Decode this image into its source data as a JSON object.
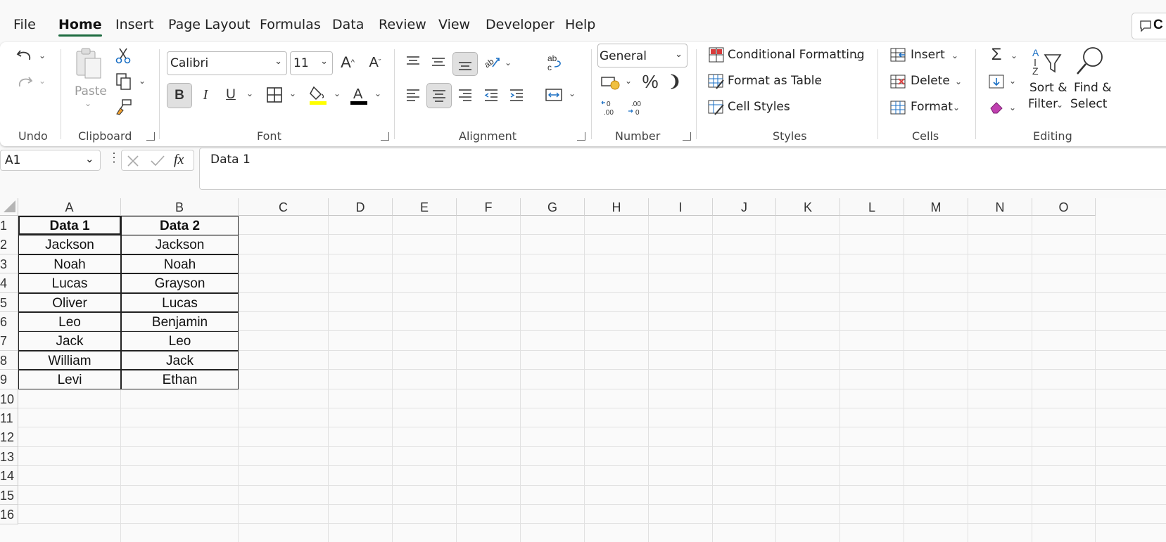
{
  "menu": {
    "tabs": [
      "File",
      "Home",
      "Insert",
      "Page Layout",
      "Formulas",
      "Data",
      "Review",
      "View",
      "Developer",
      "Help"
    ],
    "active": "Home"
  },
  "ribbon": {
    "groups": {
      "undo": "Undo",
      "clipboard": "Clipboard",
      "font": "Font",
      "alignment": "Alignment",
      "number": "Number",
      "styles": "Styles",
      "cells": "Cells",
      "editing": "Editing"
    },
    "clipboard": {
      "paste": "Paste"
    },
    "font": {
      "name": "Calibri",
      "size": "11",
      "bold": "B",
      "italic": "I",
      "underline": "U"
    },
    "number": {
      "format": "General",
      "percent": "%",
      "comma": "❩"
    },
    "styles": {
      "conditional": "Conditional Formatting",
      "format_table": "Format as Table",
      "cell_styles": "Cell Styles"
    },
    "cells": {
      "insert": "Insert",
      "delete": "Delete",
      "format": "Format"
    },
    "editing": {
      "sort1": "Sort &",
      "sort2": "Filter",
      "find1": "Find &",
      "find2": "Select"
    },
    "colors": {
      "highlight": "#ffff00",
      "font_color": "#000000"
    }
  },
  "formula_bar": {
    "name_box": "A1",
    "fx": "fx",
    "content": "Data 1"
  },
  "sheet": {
    "columns": [
      "A",
      "B",
      "C",
      "D",
      "E",
      "F",
      "G",
      "H",
      "I",
      "J",
      "K",
      "L",
      "M",
      "N",
      "O"
    ],
    "rows": [
      "1",
      "2",
      "3",
      "4",
      "5",
      "6",
      "7",
      "8",
      "9",
      "10",
      "11",
      "12",
      "13",
      "14",
      "15",
      "16"
    ],
    "table": [
      [
        "Data 1",
        "Data 2"
      ],
      [
        "Jackson",
        "Jackson"
      ],
      [
        "Noah",
        "Noah"
      ],
      [
        "Lucas",
        "Grayson"
      ],
      [
        "Oliver",
        "Lucas"
      ],
      [
        "Leo",
        "Benjamin"
      ],
      [
        "Jack",
        "Leo"
      ],
      [
        "William",
        "Jack"
      ],
      [
        "Levi",
        "Ethan"
      ]
    ]
  }
}
